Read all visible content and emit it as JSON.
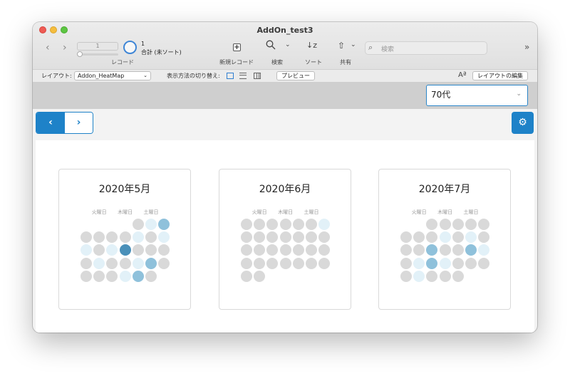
{
  "window": {
    "title": "AddOn_test3"
  },
  "toolbar": {
    "record_field_value": "1",
    "record_count": "1",
    "record_total": "合計 (未ソート)",
    "record_label": "レコード",
    "new_record_label": "新規レコード",
    "search_label": "検索",
    "sort_label": "ソート",
    "share_label": "共有",
    "search_placeholder": "検索",
    "icons": [
      "chevron-left-icon",
      "chevron-right-icon",
      "pie-icon",
      "plus-icon",
      "search-icon",
      "sort-icon",
      "share-icon",
      "overflow-icon"
    ]
  },
  "layoutbar": {
    "layout_label": "レイアウト:",
    "layout_value": "Addon_HeatMap",
    "view_label": "表示方法の切り替え:",
    "preview_label": "プレビュー",
    "edit_layout_label": "レイアウトの編集"
  },
  "header": {
    "age_value": "70代"
  },
  "colors": {
    "accent": "#1e82c8",
    "levels": [
      "#d9d9d9",
      "#e2f1f8",
      "#8fc1db",
      "#4a90b9"
    ]
  },
  "calendars": [
    {
      "title": "2020年5月",
      "weekdays": [
        "火曜日",
        "木曜日",
        "土曜日"
      ],
      "weeks": [
        [
          null,
          null,
          null,
          null,
          0,
          1,
          2
        ],
        [
          0,
          0,
          0,
          0,
          1,
          0,
          1
        ],
        [
          1,
          0,
          1,
          3,
          0,
          0,
          0
        ],
        [
          0,
          1,
          0,
          0,
          1,
          2,
          0
        ],
        [
          0,
          0,
          0,
          1,
          2,
          0,
          null
        ]
      ]
    },
    {
      "title": "2020年6月",
      "weekdays": [
        "火曜日",
        "木曜日",
        "土曜日"
      ],
      "weeks": [
        [
          0,
          0,
          0,
          0,
          0,
          0,
          1
        ],
        [
          0,
          0,
          0,
          0,
          0,
          0,
          0
        ],
        [
          0,
          0,
          0,
          0,
          0,
          0,
          0
        ],
        [
          0,
          0,
          0,
          0,
          0,
          0,
          0
        ],
        [
          0,
          0,
          null,
          null,
          null,
          null,
          null
        ]
      ]
    },
    {
      "title": "2020年7月",
      "weekdays": [
        "火曜日",
        "木曜日",
        "土曜日"
      ],
      "weeks": [
        [
          null,
          null,
          0,
          0,
          0,
          0,
          0
        ],
        [
          0,
          0,
          0,
          1,
          0,
          1,
          0
        ],
        [
          0,
          0,
          2,
          0,
          0,
          2,
          1
        ],
        [
          0,
          1,
          2,
          1,
          0,
          0,
          0
        ],
        [
          0,
          1,
          0,
          0,
          0,
          null,
          null
        ]
      ]
    }
  ]
}
